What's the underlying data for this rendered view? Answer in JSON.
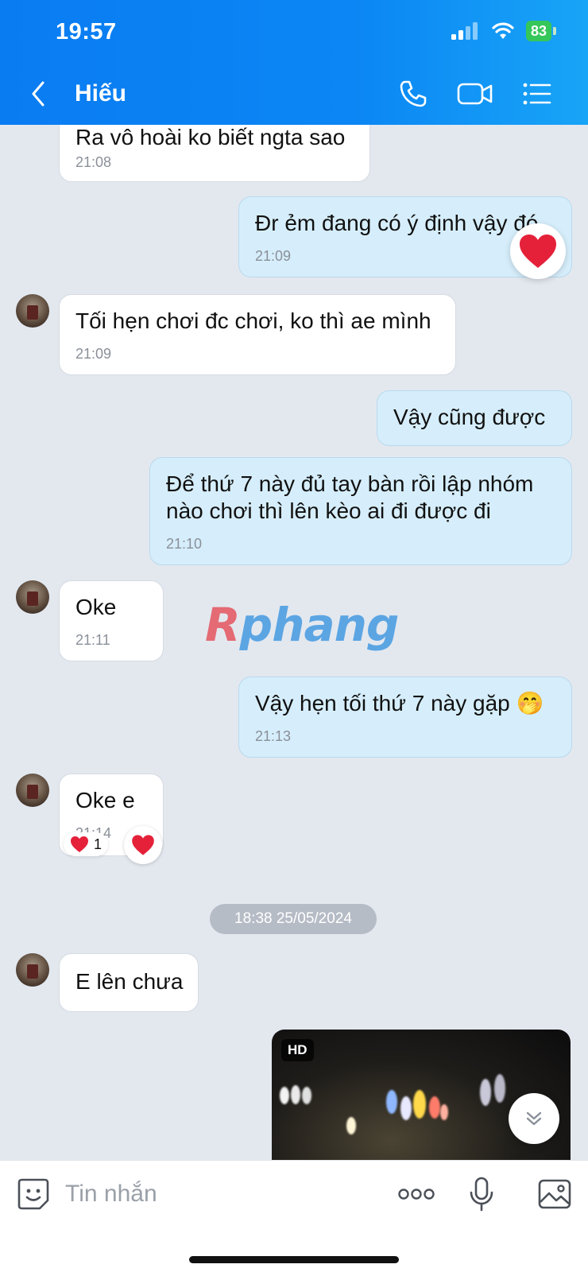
{
  "status_bar": {
    "time": "19:57",
    "battery": "83"
  },
  "header": {
    "title": "Hiếu"
  },
  "messages": {
    "m1": {
      "text": "Ra vô hoài ko biết ngta sao",
      "time": "21:08"
    },
    "m2": {
      "text": "Đr ẻm đang có ý định vậy đó",
      "time": "21:09"
    },
    "m3": {
      "text": "Tối hẹn chơi đc chơi, ko thì ae mình",
      "time": "21:09"
    },
    "m4": {
      "text": "Vậy cũng được"
    },
    "m5": {
      "line1": "Để thứ 7 này đủ tay bàn rồi lập nhóm",
      "line2": "nào chơi thì lên kèo ai đi được đi",
      "time": "21:10"
    },
    "m6": {
      "text": "Oke",
      "time": "21:11"
    },
    "m7": {
      "text": "Vậy hẹn tối thứ 7 này gặp 🤭",
      "time": "21:13"
    },
    "m8": {
      "text": "Oke e",
      "time": "21:14",
      "reaction_count": "1"
    },
    "m9": {
      "text": "E lên chưa"
    }
  },
  "date_separator": "18:38 25/05/2024",
  "media": {
    "badge": "HD"
  },
  "watermark": {
    "first": "R",
    "rest": "phang"
  },
  "input": {
    "placeholder": "Tin nhắn"
  },
  "colors": {
    "header": "#0a7cf2",
    "outgoing_bubble": "#d6eefb",
    "incoming_bubble": "#ffffff",
    "background": "#e3e8ef",
    "heart": "#e5213a"
  },
  "icons": [
    "back-arrow-icon",
    "phone-icon",
    "video-call-icon",
    "list-menu-icon",
    "heart-icon",
    "chevron-double-down-icon",
    "sticker-face-icon",
    "more-dots-icon",
    "microphone-icon",
    "image-icon"
  ]
}
